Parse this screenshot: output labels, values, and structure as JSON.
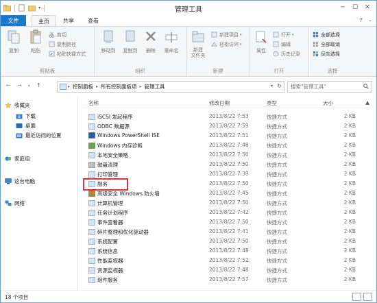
{
  "window": {
    "title": "管理工具"
  },
  "ribbon_tabs": {
    "file": "文件",
    "home": "主页",
    "share": "共享",
    "view": "查看"
  },
  "ribbon": {
    "clipboard": {
      "copy": "复制",
      "paste": "粘贴",
      "cut": "剪切",
      "copy_path": "复制路径",
      "paste_shortcut": "粘贴快捷方式",
      "label": "剪贴板"
    },
    "organize": {
      "move_to": "移动到",
      "copy_to": "复制到",
      "delete": "删除",
      "rename": "重命名",
      "label": "组织"
    },
    "new": {
      "new_folder": "新建\n文件夹",
      "new_item": "新建项目",
      "easy_access": "轻松访问",
      "label": "新建"
    },
    "open": {
      "properties": "属性",
      "open": "打开",
      "edit": "编辑",
      "history": "历史记录",
      "label": "打开"
    },
    "select": {
      "select_all": "全部选择",
      "select_none": "全部取消",
      "invert": "反向选择",
      "label": "选择"
    }
  },
  "address": {
    "crumbs": [
      "控制面板",
      "所有控制面板项",
      "管理工具"
    ],
    "search_placeholder": "搜索\"管理工具\""
  },
  "nav": {
    "favorites": "收藏夹",
    "downloads": "下载",
    "desktop": "桌面",
    "recent": "最近访问的位置",
    "homegroup": "家庭组",
    "this_pc": "这台电脑",
    "network": "网络"
  },
  "columns": {
    "name": "名称",
    "date": "修改日期",
    "type": "类型",
    "size": "大小"
  },
  "files": [
    {
      "name": "iSCSI 发起程序",
      "date": "2013/8/22 7:53",
      "type": "快捷方式",
      "size": "2 KB"
    },
    {
      "name": "ODBC 数据源",
      "date": "2013/8/22 7:59",
      "type": "快捷方式",
      "size": "2 KB"
    },
    {
      "name": "Windows PowerShell ISE",
      "date": "2013/8/22 7:51",
      "type": "快捷方式",
      "size": "2 KB"
    },
    {
      "name": "Windows 内存诊断",
      "date": "2013/8/22 7:48",
      "type": "快捷方式",
      "size": "2 KB"
    },
    {
      "name": "本地安全策略",
      "date": "2013/8/22 7:50",
      "type": "快捷方式",
      "size": "2 KB"
    },
    {
      "name": "磁盘清理",
      "date": "2013/8/22 7:50",
      "type": "快捷方式",
      "size": "2 KB"
    },
    {
      "name": "打印管理",
      "date": "2013/8/22 7:39",
      "type": "快捷方式",
      "size": "2 KB"
    },
    {
      "name": "服务",
      "date": "2013/8/22 7:50",
      "type": "快捷方式",
      "size": "2 KB"
    },
    {
      "name": "高级安全 Windows 防火墙",
      "date": "2013/8/22 7:45",
      "type": "快捷方式",
      "size": "2 KB"
    },
    {
      "name": "计算机管理",
      "date": "2013/8/22 7:50",
      "type": "快捷方式",
      "size": "2 KB"
    },
    {
      "name": "任务计划程序",
      "date": "2013/8/22 7:42",
      "type": "快捷方式",
      "size": "2 KB"
    },
    {
      "name": "事件查看器",
      "date": "2013/8/22 7:50",
      "type": "快捷方式",
      "size": "2 KB"
    },
    {
      "name": "碎片整理和优化驱动器",
      "date": "2013/8/22 7:41",
      "type": "快捷方式",
      "size": "2 KB"
    },
    {
      "name": "系统配置",
      "date": "2013/8/22 7:50",
      "type": "快捷方式",
      "size": "2 KB"
    },
    {
      "name": "系统信息",
      "date": "2013/8/22 7:48",
      "type": "快捷方式",
      "size": "2 KB"
    },
    {
      "name": "性能监视器",
      "date": "2013/8/22 7:52",
      "type": "快捷方式",
      "size": "2 KB"
    },
    {
      "name": "资源监视器",
      "date": "2013/8/22 7:48",
      "type": "快捷方式",
      "size": "2 KB"
    },
    {
      "name": "组件服务",
      "date": "2013/8/22 7:57",
      "type": "快捷方式",
      "size": "2 KB"
    }
  ],
  "status": {
    "item_count": "18 个项目"
  },
  "colors": {
    "accent": "#1979ca",
    "highlight": "#e0323b"
  }
}
